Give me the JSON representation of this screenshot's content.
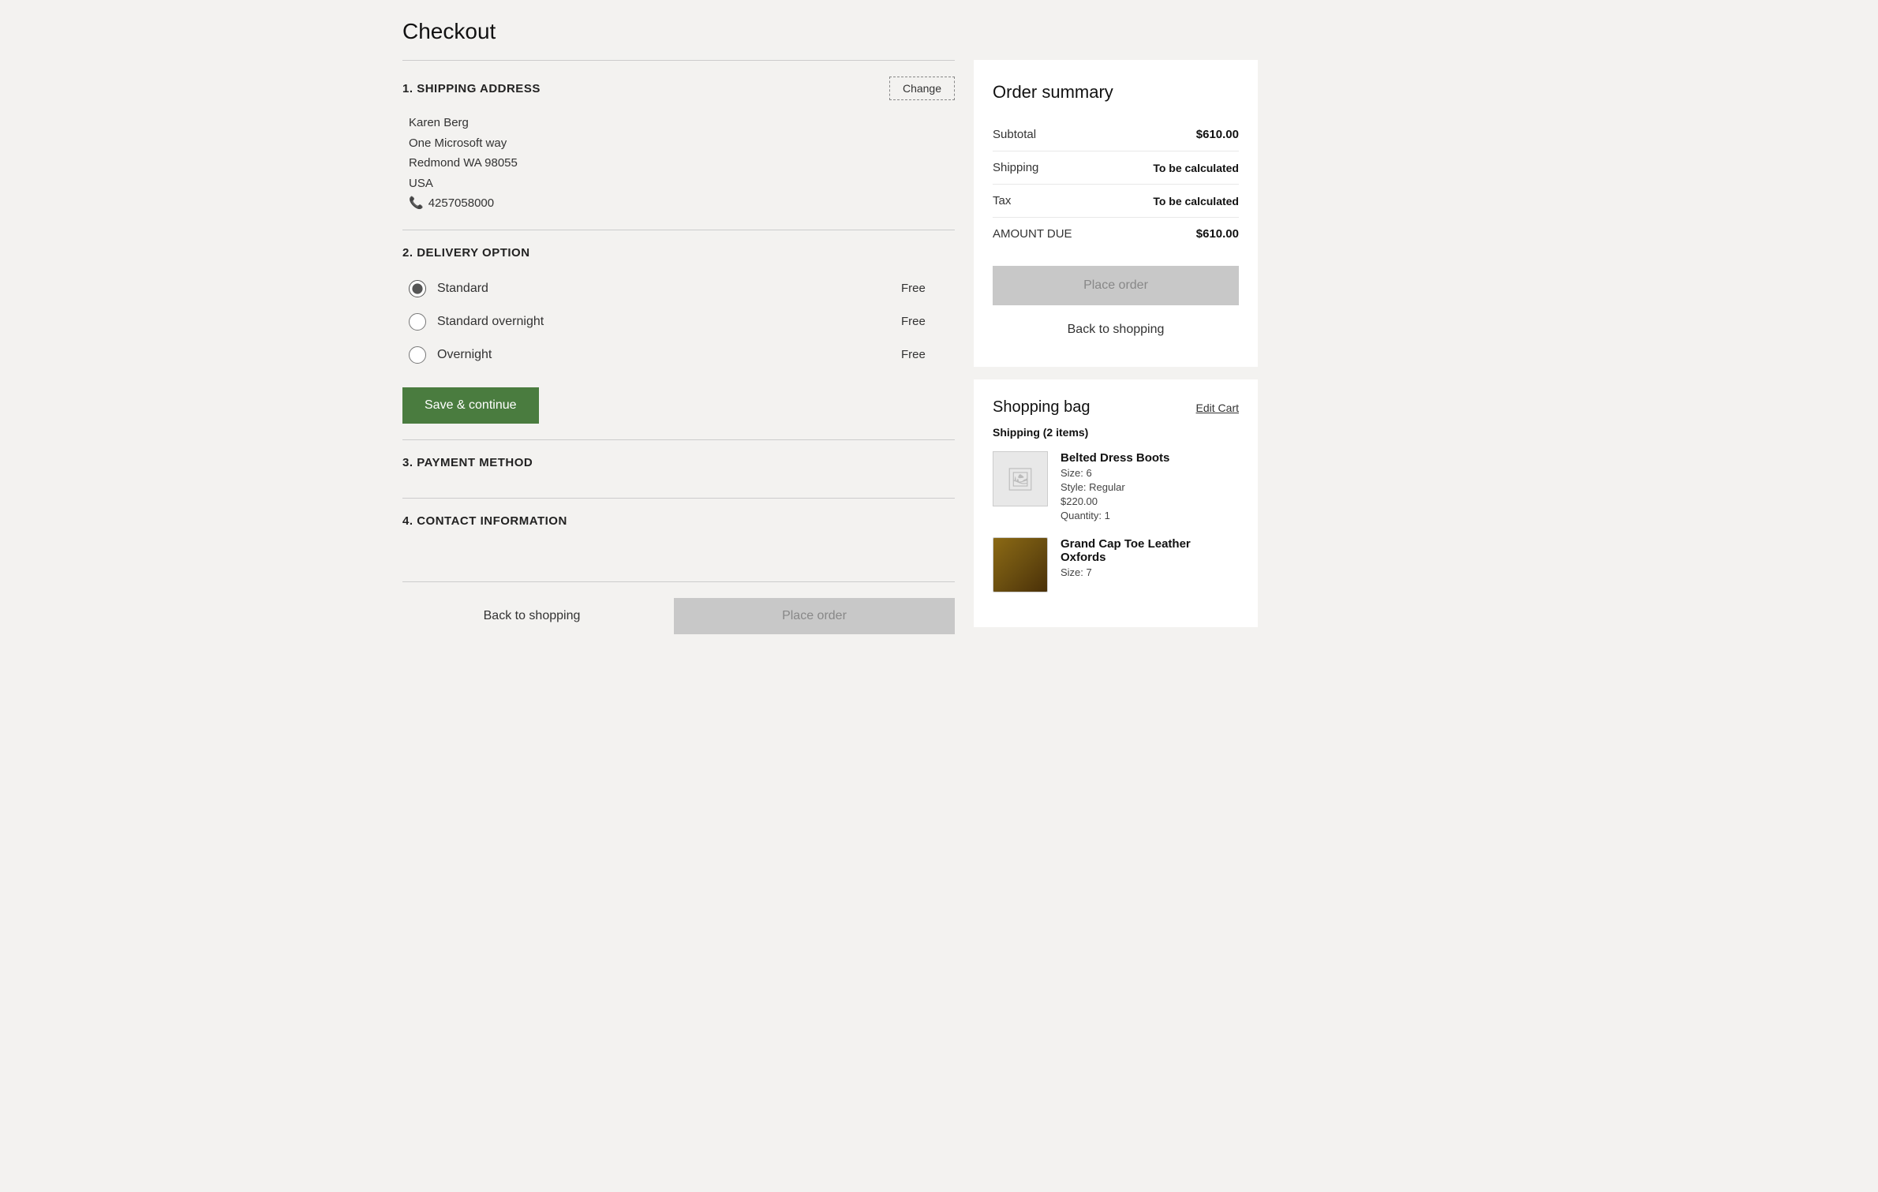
{
  "page": {
    "title": "Checkout"
  },
  "sections": {
    "shipping_address": {
      "number": "1.",
      "title": "SHIPPING ADDRESS",
      "change_label": "Change",
      "address": {
        "name": "Karen Berg",
        "street": "One Microsoft way",
        "city_state_zip": "Redmond WA  98055",
        "country": "USA",
        "phone": "4257058000"
      }
    },
    "delivery_option": {
      "number": "2.",
      "title": "DELIVERY OPTION",
      "options": [
        {
          "id": "standard",
          "label": "Standard",
          "price": "Free",
          "checked": true
        },
        {
          "id": "standard_overnight",
          "label": "Standard overnight",
          "price": "Free",
          "checked": false
        },
        {
          "id": "overnight",
          "label": "Overnight",
          "price": "Free",
          "checked": false
        }
      ],
      "save_button_label": "Save & continue"
    },
    "payment_method": {
      "number": "3.",
      "title": "PAYMENT METHOD"
    },
    "contact_information": {
      "number": "4.",
      "title": "CONTACT INFORMATION"
    }
  },
  "bottom_actions": {
    "back_label": "Back to shopping",
    "place_order_label": "Place order"
  },
  "order_summary": {
    "title": "Order summary",
    "rows": [
      {
        "label": "Subtotal",
        "value": "$610.00",
        "bold": true
      },
      {
        "label": "Shipping",
        "value": "To be calculated",
        "bold": true
      },
      {
        "label": "Tax",
        "value": "To be calculated",
        "bold": true
      },
      {
        "label": "AMOUNT DUE",
        "value": "$610.00",
        "bold": true
      }
    ],
    "place_order_label": "Place order",
    "back_shopping_label": "Back to shopping"
  },
  "shopping_bag": {
    "title": "Shopping bag",
    "edit_cart_label": "Edit Cart",
    "shipping_label": "Shipping (2 items)",
    "items": [
      {
        "name": "Belted Dress Boots",
        "size": "Size: 6",
        "style": "Style: Regular",
        "price": "$220.00",
        "quantity": "Quantity: 1",
        "has_image": false
      },
      {
        "name": "Grand Cap Toe Leather Oxfords",
        "size": "Size: 7",
        "has_image": true
      }
    ]
  }
}
